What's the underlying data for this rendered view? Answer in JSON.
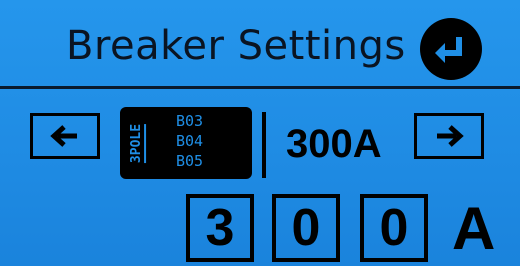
{
  "header": {
    "title": "Breaker Settings",
    "enter_icon": "enter-return-icon"
  },
  "selector": {
    "prev_icon": "arrow-left-icon",
    "next_icon": "arrow-right-icon",
    "pole_label": "3POLE",
    "breakers": [
      "B03",
      "B04",
      "B05"
    ],
    "current_rating": "300A"
  },
  "editor": {
    "digits": [
      "3",
      "0",
      "0"
    ],
    "unit": "A"
  },
  "colors": {
    "background": "#1f8fe6",
    "foreground": "#000000"
  }
}
